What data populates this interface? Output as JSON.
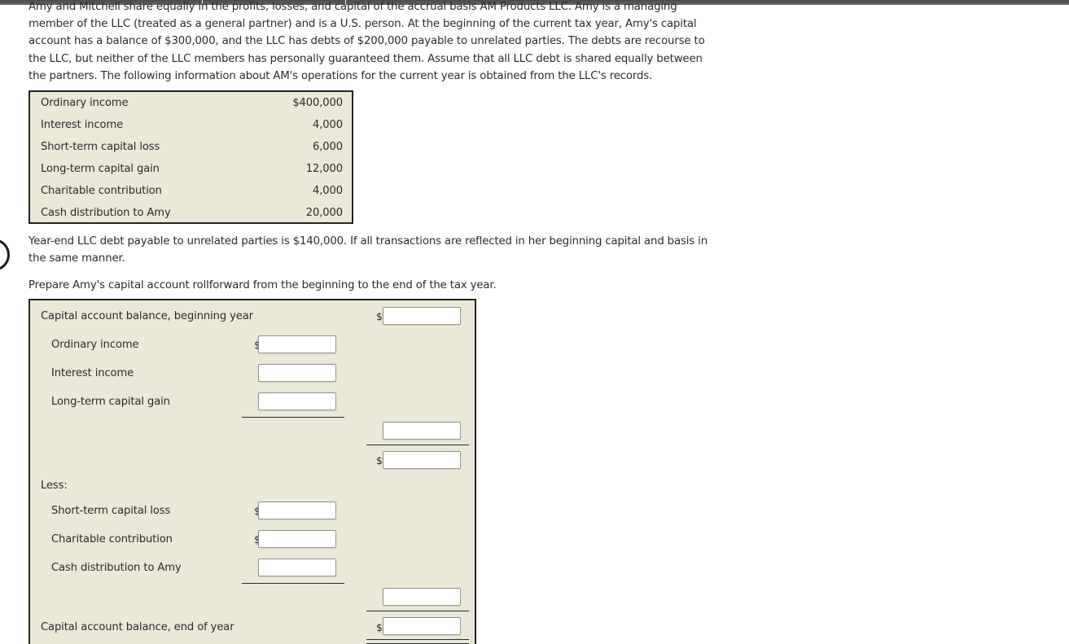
{
  "problem": {
    "intro": "Amy and Mitchell share equally in the profits, losses, and capital of the accrual basis AM Products LLC. Amy is a managing member of the LLC (treated as a general partner) and is a U.S. person. At the beginning of the current tax year, Amy's capital account has a balance of $300,000, and the LLC has debts of $200,000 payable to unrelated parties. The debts are recourse to the LLC, but neither of the LLC members has personally guaranteed them. Assume that all LLC debt is shared equally between the partners. The following information about AM's operations for the current year is obtained from the LLC's records.",
    "year_end_note": "Year-end LLC debt payable to unrelated parties is $140,000. If all transactions are reflected in her beginning capital and basis in the same manner.",
    "instruction": "Prepare Amy's capital account rollforward from the beginning to the end of the tax year."
  },
  "given_data": {
    "rows": [
      {
        "label": "Ordinary income",
        "amount": "$400,000"
      },
      {
        "label": "Interest income",
        "amount": "4,000"
      },
      {
        "label": "Short-term capital loss",
        "amount": "6,000"
      },
      {
        "label": "Long-term capital gain",
        "amount": "12,000"
      },
      {
        "label": "Charitable contribution",
        "amount": "4,000"
      },
      {
        "label": "Cash distribution to Amy",
        "amount": "20,000"
      }
    ]
  },
  "answer_form": {
    "beginning_label": "Capital account balance, beginning year",
    "additions": [
      {
        "label": "Ordinary income",
        "dollar": "$",
        "value": ""
      },
      {
        "label": "Interest income",
        "dollar": "",
        "value": ""
      },
      {
        "label": "Long-term capital gain",
        "dollar": "",
        "value": ""
      }
    ],
    "less_label": "Less:",
    "subtractions": [
      {
        "label": "Short-term capital loss",
        "dollar": "$",
        "value": ""
      },
      {
        "label": "Charitable contribution",
        "dollar": "$",
        "value": ""
      },
      {
        "label": "Cash distribution to Amy",
        "dollar": "",
        "value": ""
      }
    ],
    "ending_label": "Capital account balance, end of year",
    "dollar_symbol": "$",
    "beginning_value": "",
    "additions_subtotal_value": "",
    "after_additions_value": "",
    "subtractions_subtotal_value": "",
    "ending_value": ""
  },
  "colors": {
    "panel_bg": "#EAE8D7",
    "page_bg": "#FFFFFF",
    "border": "#232323",
    "text": "#2B2B2B",
    "chrome_bar": "#575757"
  }
}
